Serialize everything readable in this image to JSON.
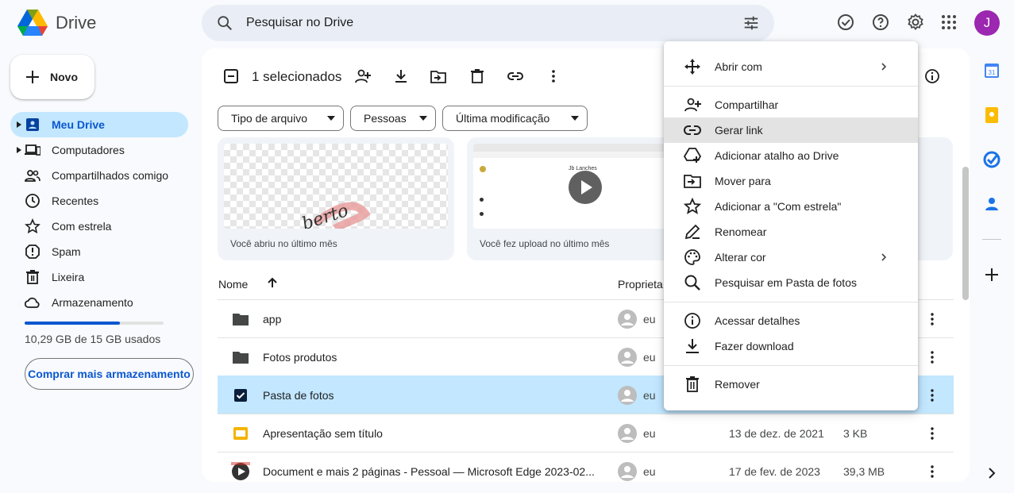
{
  "app": {
    "name": "Drive"
  },
  "search": {
    "placeholder": "Pesquisar no Drive"
  },
  "user": {
    "initial": "J",
    "color": "#9c27b0"
  },
  "sidebar": {
    "new_label": "Novo",
    "items": [
      {
        "label": "Meu Drive",
        "icon": "my-drive-icon",
        "active": true
      },
      {
        "label": "Computadores",
        "icon": "computers-icon"
      },
      {
        "label": "Compartilhados comigo",
        "icon": "shared-icon"
      },
      {
        "label": "Recentes",
        "icon": "clock-icon"
      },
      {
        "label": "Com estrela",
        "icon": "star-icon"
      },
      {
        "label": "Spam",
        "icon": "spam-icon"
      },
      {
        "label": "Lixeira",
        "icon": "trash-icon"
      },
      {
        "label": "Armazenamento",
        "icon": "cloud-icon"
      }
    ],
    "storage": {
      "text": "10,29 GB de 15 GB usados",
      "used_fraction": 0.686
    },
    "buy_label": "Comprar mais armazenamento"
  },
  "toolbar": {
    "selected_label": "1 selecionados"
  },
  "filters": [
    "Tipo de arquivo",
    "Pessoas",
    "Última modificação"
  ],
  "suggested": [
    {
      "caption": "Você abriu no último mês",
      "thumb_text": "berto"
    },
    {
      "caption": "Você fez upload no último mês",
      "thumb_text": "Jb Lanches"
    }
  ],
  "columns": {
    "name": "Nome",
    "owner": "Proprieta"
  },
  "rows": [
    {
      "name": "app",
      "type": "folder",
      "owner": "eu",
      "date": "",
      "size": ""
    },
    {
      "name": "Fotos produtos",
      "type": "folder",
      "owner": "eu",
      "date": "",
      "size": ""
    },
    {
      "name": "Pasta de fotos",
      "type": "folder",
      "owner": "eu",
      "date": "",
      "size": "",
      "selected": true
    },
    {
      "name": "Apresentação sem título",
      "type": "slides",
      "owner": "eu",
      "date": "13 de dez. de 2021",
      "size": "3 KB"
    },
    {
      "name": "Document e mais 2 páginas - Pessoal — Microsoft Edge 2023-02...",
      "type": "video",
      "owner": "eu",
      "date": "17 de fev. de 2023",
      "size": "39,3 MB"
    }
  ],
  "context_menu": {
    "items": [
      {
        "label": "Abrir com",
        "icon": "open-with-icon",
        "submenu": true
      },
      {
        "label": "Compartilhar",
        "icon": "share-icon"
      },
      {
        "label": "Gerar link",
        "icon": "link-icon",
        "hover": true
      },
      {
        "label": "Adicionar atalho ao Drive",
        "icon": "add-shortcut-icon"
      },
      {
        "label": "Mover para",
        "icon": "move-icon"
      },
      {
        "label": "Adicionar a \"Com estrela\"",
        "icon": "star-icon"
      },
      {
        "label": "Renomear",
        "icon": "rename-icon"
      },
      {
        "label": "Alterar cor",
        "icon": "palette-icon",
        "submenu": true
      },
      {
        "label": "Pesquisar em Pasta de fotos",
        "icon": "search-icon"
      },
      {
        "label": "Acessar detalhes",
        "icon": "info-icon"
      },
      {
        "label": "Fazer download",
        "icon": "download-icon"
      },
      {
        "label": "Remover",
        "icon": "trash-icon"
      }
    ]
  },
  "colors": {
    "accent": "#0b57d0",
    "selected": "#c2e7ff",
    "search_bg": "#e9eef6"
  }
}
